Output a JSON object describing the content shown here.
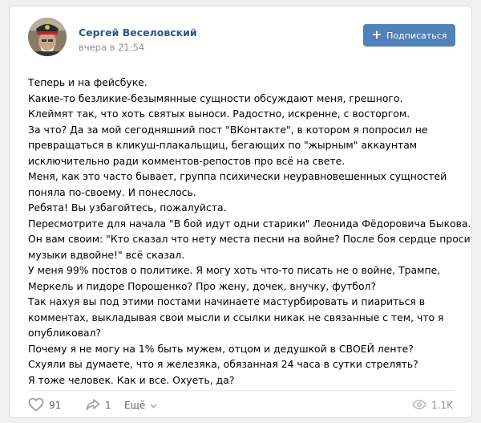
{
  "post": {
    "author": "Сергей Веселовский",
    "time": "вчера в 21:54",
    "subscribe_label": "Подписаться",
    "subscribe_icon": "plus-icon",
    "lines": [
      "Теперь и на фейсбуке.",
      "Какие-то безликие-безымянные сущности обсуждают меня, грешного.",
      "Клеймят так, что хоть святых выноси. Радостно, искренне, с восторгом.",
      "За что? Да за мой сегодняшний пост \"ВКонтакте\", в котором я попросил не",
      "превращаться в кликуш-плакальщиц, бегающих по \"жырным\" аккаунтам",
      "исключительно ради комментов-репостов про всё на свете.",
      "Меня, как это часто бывает, группа психически неуравновешенных сущностей",
      "поняла по-своему. И понеслось.",
      "Ребята! Вы узбагойтесь, пожалуйста.",
      "Пересмотрите для начала \"В бой идут одни старики\" Леонида Фёдоровича Быкова.",
      "Он вам своим: \"Кто сказал что нету места песни на войне? После боя сердце просит",
      "музыки вдвойне!\" всё сказал.",
      "У меня 99% постов о политике. Я могу хоть что-то писать не о войне, Трампе,",
      "Меркель и пидоре Порошенко? Про жену, дочек, внучку, футбол?",
      "Так нахуя вы под этими постами начинаете мастурбировать и пиариться в",
      "комментах, выкладывая свои мысли и ссылки никак не связанные с тем, что я",
      "опубликовал?",
      "Почему я не могу на 1% быть мужем, отцом и дедушкой в СВОЕЙ ленте?",
      "Схуяли вы думаете, что я железяка, обязанная 24 часа в сутки стрелять?",
      "Я тоже человек. Как и все. Охуеть, да?"
    ]
  },
  "footer": {
    "likes": "91",
    "shares": "1",
    "more_label": "Ещё",
    "views": "1.1K",
    "icons": {
      "like": "heart-icon",
      "share": "share-icon",
      "more": "chevron-down-icon",
      "views": "eye-icon"
    }
  },
  "colors": {
    "accent": "#5181b8",
    "author": "#2a5885",
    "muted": "#939393",
    "icon": "#99a2ad"
  }
}
